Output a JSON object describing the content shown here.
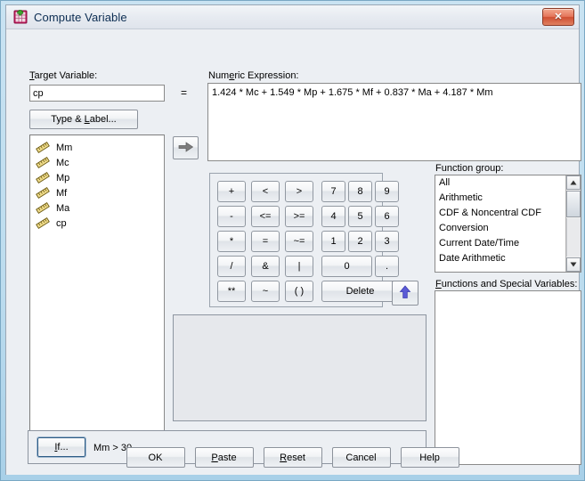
{
  "window": {
    "title": "Compute Variable",
    "app_icon": "spss-compute-icon",
    "close_label": "✕"
  },
  "target": {
    "label": "Target Variable:",
    "label_accel": "T",
    "value": "cp",
    "equals": "=",
    "type_label_button": "Type & Label...",
    "type_label_accel": "L"
  },
  "variables": {
    "items": [
      {
        "name": "Mm",
        "icon": "scale-ruler-icon"
      },
      {
        "name": "Mc",
        "icon": "scale-ruler-icon"
      },
      {
        "name": "Mp",
        "icon": "scale-ruler-icon"
      },
      {
        "name": "Mf",
        "icon": "scale-ruler-icon"
      },
      {
        "name": "Ma",
        "icon": "scale-ruler-icon"
      },
      {
        "name": "cp",
        "icon": "scale-ruler-icon"
      }
    ]
  },
  "transfer": {
    "right_arrow_icon": "arrow-right-icon",
    "up_arrow_icon": "arrow-up-icon"
  },
  "expression": {
    "label": "Numeric Expression:",
    "label_accel": "e",
    "value": "1.424 * Mc + 1.549 * Mp + 1.675 * Mf + 0.837 * Ma + 4.187 * Mm"
  },
  "keypad": {
    "rows": [
      [
        "+",
        "<",
        ">",
        "7",
        "8",
        "9"
      ],
      [
        "-",
        "<=",
        ">=",
        "4",
        "5",
        "6"
      ],
      [
        "*",
        "=",
        "~=",
        "1",
        "2",
        "3"
      ],
      [
        "/",
        "&",
        "|",
        "0",
        "."
      ],
      [
        "**",
        "~",
        "( )",
        "Delete"
      ]
    ],
    "keys": {
      "plus": "+",
      "lt": "<",
      "gt": ">",
      "seven": "7",
      "eight": "8",
      "nine": "9",
      "minus": "-",
      "lte": "<=",
      "gte": ">=",
      "four": "4",
      "five": "5",
      "six": "6",
      "times": "*",
      "eq": "=",
      "neq": "~=",
      "one": "1",
      "two": "2",
      "three": "3",
      "divide": "/",
      "and": "&",
      "or": "|",
      "zero": "0",
      "dot": ".",
      "power": "**",
      "not": "~",
      "parens": "( )",
      "delete": "Delete"
    }
  },
  "function_group": {
    "label": "Function group:",
    "label_accel": "g",
    "items": [
      "All",
      "Arithmetic",
      "CDF & Noncentral CDF",
      "Conversion",
      "Current Date/Time",
      "Date Arithmetic"
    ]
  },
  "functions_list": {
    "label": "Functions and Special Variables:",
    "label_accel": "F",
    "items": []
  },
  "condition": {
    "button_label": "If...",
    "button_accel": "I",
    "text": "Mm > 30"
  },
  "footer": {
    "buttons": [
      {
        "key": "ok",
        "label": "OK"
      },
      {
        "key": "paste",
        "label": "Paste"
      },
      {
        "key": "reset",
        "label": "Reset"
      },
      {
        "key": "cancel",
        "label": "Cancel"
      },
      {
        "key": "help",
        "label": "Help"
      }
    ],
    "ok": "OK",
    "paste": "Paste",
    "reset": "Reset",
    "cancel": "Cancel",
    "help": "Help"
  },
  "colors": {
    "window_frame": "#bcdcee",
    "dialog_bg": "#eceff3",
    "field_bg": "#ffffff",
    "title_text": "#0c2d52",
    "close_button": "#cf4f32",
    "focus_border": "#2e5c86",
    "variable_icon": "#e8d070"
  }
}
